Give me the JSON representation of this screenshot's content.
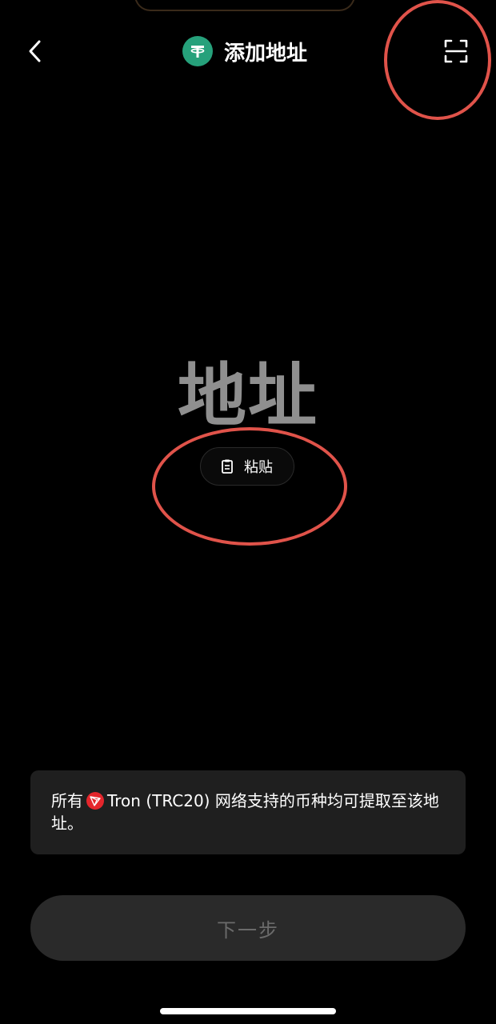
{
  "header": {
    "title": "添加地址",
    "token_icon": "tether-usdt-icon",
    "back_icon": "chevron-left-icon",
    "scan_icon": "scan-icon"
  },
  "address": {
    "placeholder": "地址",
    "paste_label": "粘贴",
    "paste_icon": "clipboard-icon"
  },
  "info": {
    "prefix": "所有",
    "network_icon": "tron-icon",
    "network": "Tron (TRC20)",
    "suffix": "网络支持的币种均可提取至该地址。"
  },
  "footer": {
    "next_label": "下一步"
  },
  "colors": {
    "background": "#000000",
    "accent_ring": "#e0534a",
    "usdt_green": "#26a17b",
    "tron_red": "#e5262c",
    "placeholder_gray": "#8f8f8f",
    "card_bg": "#1f1f1f",
    "button_disabled_bg": "#2a2a2a",
    "button_disabled_text": "#6b6b6b"
  }
}
